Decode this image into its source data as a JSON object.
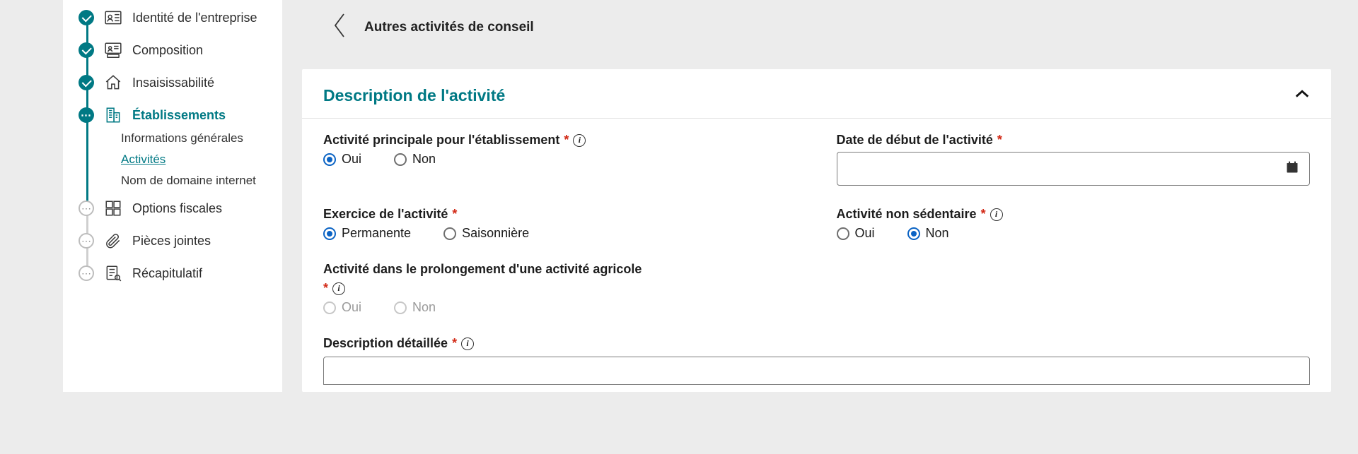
{
  "sidebar": {
    "steps": [
      {
        "label": "Identité de l'entreprise"
      },
      {
        "label": "Composition"
      },
      {
        "label": "Insaisissabilité"
      },
      {
        "label": "Établissements"
      },
      {
        "label": "Options fiscales"
      },
      {
        "label": "Pièces jointes"
      },
      {
        "label": "Récapitulatif"
      }
    ],
    "substeps": [
      {
        "label": "Informations générales"
      },
      {
        "label": "Activités"
      },
      {
        "label": "Nom de domaine internet"
      }
    ]
  },
  "main": {
    "back_label": "Autres activités de conseil",
    "panel_title": "Description de l'activité",
    "fields": {
      "principal": {
        "label": "Activité principale pour l'établissement",
        "options": {
          "yes": "Oui",
          "no": "Non"
        },
        "value": "Oui"
      },
      "start_date": {
        "label": "Date de début de l'activité",
        "value": ""
      },
      "exercise": {
        "label": "Exercice de l'activité",
        "options": {
          "perm": "Permanente",
          "seas": "Saisonnière"
        },
        "value": "Permanente"
      },
      "non_sedentary": {
        "label": "Activité non sédentaire",
        "options": {
          "yes": "Oui",
          "no": "Non"
        },
        "value": "Non"
      },
      "agricultural": {
        "label": "Activité dans le prolongement d'une activité agricole",
        "options": {
          "yes": "Oui",
          "no": "Non"
        },
        "value": ""
      },
      "description": {
        "label": "Description détaillée",
        "value": ""
      }
    }
  }
}
